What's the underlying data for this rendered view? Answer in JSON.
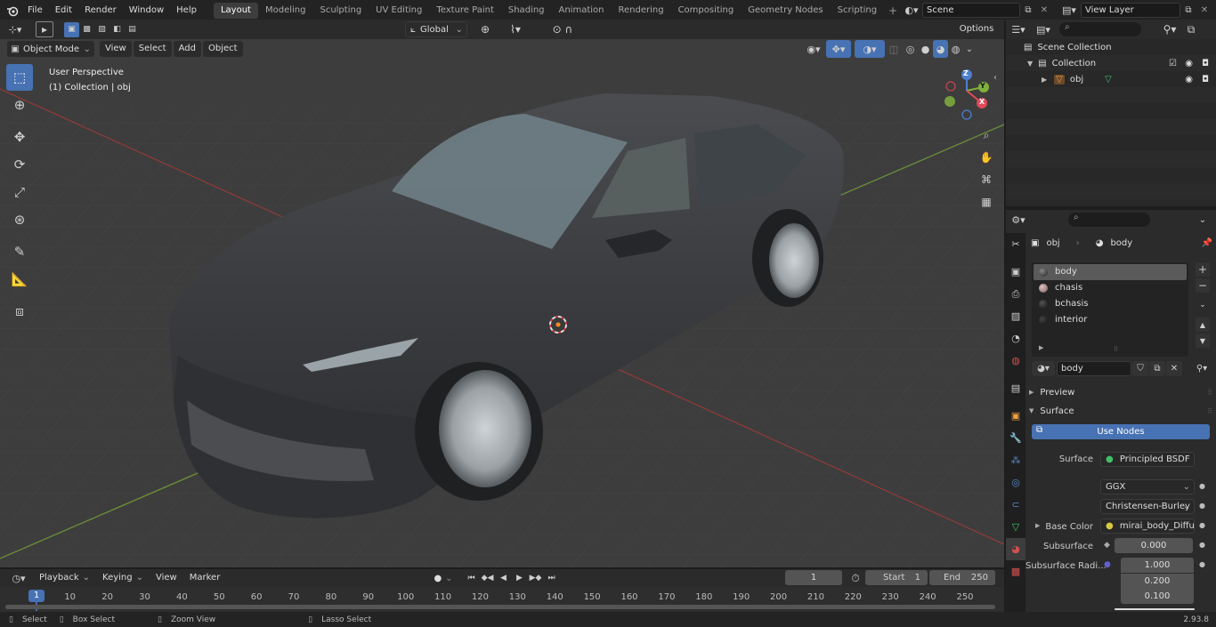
{
  "topbar": {
    "menus": [
      "File",
      "Edit",
      "Render",
      "Window",
      "Help"
    ],
    "workspaces": [
      "Layout",
      "Modeling",
      "Sculpting",
      "UV Editing",
      "Texture Paint",
      "Shading",
      "Animation",
      "Rendering",
      "Compositing",
      "Geometry Nodes",
      "Scripting"
    ],
    "active_workspace": "Layout",
    "scene": "Scene",
    "view_layer": "View Layer"
  },
  "viewport": {
    "mode": "Object Mode",
    "menus": [
      "View",
      "Select",
      "Add",
      "Object"
    ],
    "transform_orientation": "Global",
    "options_label": "Options",
    "overlay_title": "User Perspective",
    "overlay_collection": "(1) Collection | obj",
    "gizmo_axes": {
      "x": "X",
      "y": "Y",
      "z": "Z"
    }
  },
  "outliner": {
    "scene_collection": "Scene Collection",
    "collection": "Collection",
    "object": "obj"
  },
  "properties": {
    "breadcrumb_object": "obj",
    "breadcrumb_material": "body",
    "materials": [
      "body",
      "chasis",
      "bchasis",
      "interior"
    ],
    "selected_material": "body",
    "material_name": "body",
    "preview_label": "Preview",
    "surface_label": "Surface",
    "use_nodes_label": "Use Nodes",
    "surface_shader_label": "Surface",
    "surface_shader": "Principled BSDF",
    "distribution": "GGX",
    "subsurface_method": "Christensen-Burley",
    "base_color_label": "Base Color",
    "base_color_value": "mirai_body_Diffuse ...",
    "subsurface_label": "Subsurface",
    "subsurface_value": "0.000",
    "subsurface_radius_label": "Subsurface Radi...",
    "subsurface_radius": [
      "1.000",
      "0.200",
      "0.100"
    ]
  },
  "timeline": {
    "menus": [
      "Playback",
      "Keying",
      "View",
      "Marker"
    ],
    "current_frame": "1",
    "start_label": "Start",
    "start_value": "1",
    "end_label": "End",
    "end_value": "250",
    "ruler_current": "1",
    "ruler_ticks": [
      "10",
      "20",
      "30",
      "40",
      "50",
      "60",
      "70",
      "80",
      "90",
      "100",
      "110",
      "120",
      "130",
      "140",
      "150",
      "160",
      "170",
      "180",
      "190",
      "200",
      "210",
      "220",
      "230",
      "240",
      "250"
    ]
  },
  "statusbar": {
    "select": "Select",
    "box_select": "Box Select",
    "zoom_view": "Zoom View",
    "lasso_select": "Lasso Select",
    "version": "2.93.8"
  },
  "colors": {
    "accent": "#4772b3",
    "panel_bg": "#2b2b2b",
    "viewport_bg": "#3d3d3d",
    "grid_red": "#8a3a3a",
    "grid_green": "#6a8a3a",
    "car_body": "#3a3b3d"
  }
}
